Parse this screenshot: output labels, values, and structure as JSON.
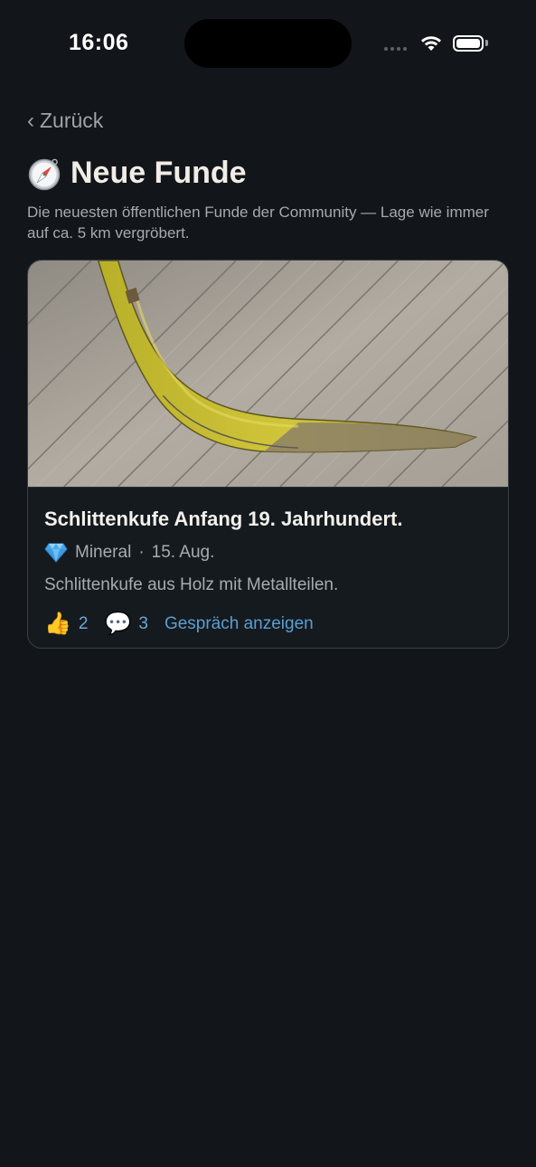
{
  "status_bar": {
    "time": "16:06"
  },
  "header": {
    "back_label": "Zurück",
    "title": "Neue Funde",
    "subtitle": "Die neuesten öffentlichen Funde der Community — Lage wie immer auf ca. 5 km vergröbert."
  },
  "finds": [
    {
      "title": "Schlittenkufe Anfang 19. Jahrhundert.",
      "category": "Mineral",
      "date": "15. Aug.",
      "description": "Schlittenkufe aus Holz mit Metallteilen.",
      "likes": "2",
      "comments": "3",
      "conversation_label": "Gespräch anzeigen"
    }
  ],
  "icons": {
    "back": "chevron-left-icon",
    "title": "compass-icon",
    "category": "gem-icon",
    "likes": "thumbs-up-icon",
    "comments": "speech-bubble-icon"
  },
  "colors": {
    "background": "#12161a",
    "link": "#5b9ed1",
    "card_border": "#3a3f45"
  }
}
